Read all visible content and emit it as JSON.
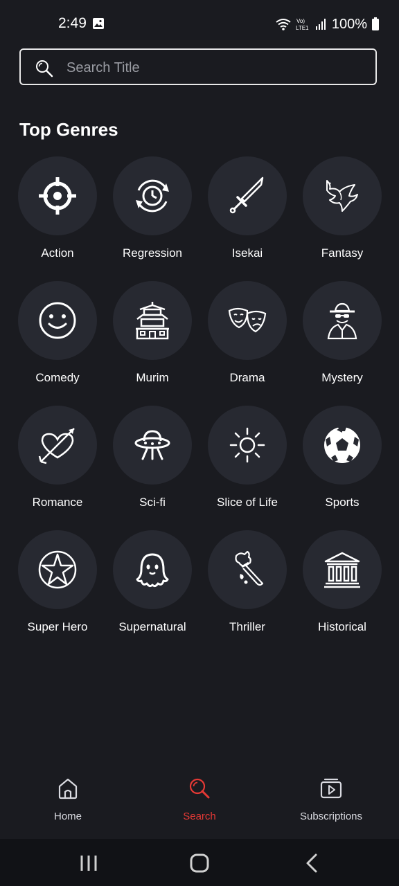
{
  "status_bar": {
    "time": "2:49",
    "battery": "100%",
    "network": "LTE1"
  },
  "search": {
    "placeholder": "Search Title"
  },
  "section": {
    "title": "Top Genres"
  },
  "genres": [
    {
      "label": "Action",
      "icon": "crosshair-icon"
    },
    {
      "label": "Regression",
      "icon": "clock-rewind-icon"
    },
    {
      "label": "Isekai",
      "icon": "sword-icon"
    },
    {
      "label": "Fantasy",
      "icon": "dragon-icon"
    },
    {
      "label": "Comedy",
      "icon": "smiley-icon"
    },
    {
      "label": "Murim",
      "icon": "pagoda-icon"
    },
    {
      "label": "Drama",
      "icon": "theater-masks-icon"
    },
    {
      "label": "Mystery",
      "icon": "detective-icon"
    },
    {
      "label": "Romance",
      "icon": "heart-arrow-icon"
    },
    {
      "label": "Sci-fi",
      "icon": "ufo-icon"
    },
    {
      "label": "Slice of Life",
      "icon": "sun-icon"
    },
    {
      "label": "Sports",
      "icon": "soccer-ball-icon"
    },
    {
      "label": "Super Hero",
      "icon": "star-badge-icon"
    },
    {
      "label": "Supernatural",
      "icon": "ghost-icon"
    },
    {
      "label": "Thriller",
      "icon": "knife-hand-icon"
    },
    {
      "label": "Historical",
      "icon": "museum-icon"
    }
  ],
  "bottom_nav": {
    "home": "Home",
    "search": "Search",
    "subscriptions": "Subscriptions",
    "active": "search",
    "active_color": "#e53935"
  },
  "colors": {
    "background": "#1a1b20",
    "circle": "#272931"
  }
}
